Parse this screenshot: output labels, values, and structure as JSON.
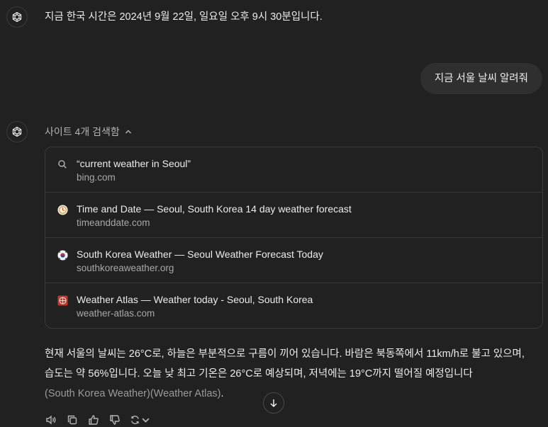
{
  "messages": {
    "assistant_1": "지금 한국 시간은 2024년 9월 22일, 일요일 오후 9시 30분입니다.",
    "user_1": "지금 서울 날씨 알려줘"
  },
  "search": {
    "toggle_label": "사이트 4개 검색함",
    "sources": [
      {
        "title": "“current weather in Seoul”",
        "domain": "bing.com",
        "icon": "search-icon"
      },
      {
        "title": "Time and Date — Seoul, South Korea 14 day weather forecast",
        "domain": "timeanddate.com",
        "icon": "timeanddate-favicon"
      },
      {
        "title": "South Korea Weather — Seoul Weather Forecast Today",
        "domain": "southkoreaweather.org",
        "icon": "korea-flag-favicon"
      },
      {
        "title": "Weather Atlas — Weather today - Seoul, South Korea",
        "domain": "weather-atlas.com",
        "icon": "weather-atlas-favicon"
      }
    ]
  },
  "answer": {
    "line1": "현재 서울의 날씨는 26°C로, 하늘은 부분적으로 구름이 끼어 있습니다. 바람은 북동쪽에서 11km/h로 불고 있으며,",
    "line2": "습도는 약 56%입니다. 오늘 낮 최고 기온은 26°C로 예상되며, 저녁에는 19°C까지 떨어질 예정입니다",
    "citation": "(South Korea Weather)(Weather Atlas)",
    "end": "."
  },
  "colors": {
    "background": "#212121",
    "bubble": "#2f2f2f",
    "border": "#3a3a3a",
    "muted": "#a8a8a8"
  }
}
